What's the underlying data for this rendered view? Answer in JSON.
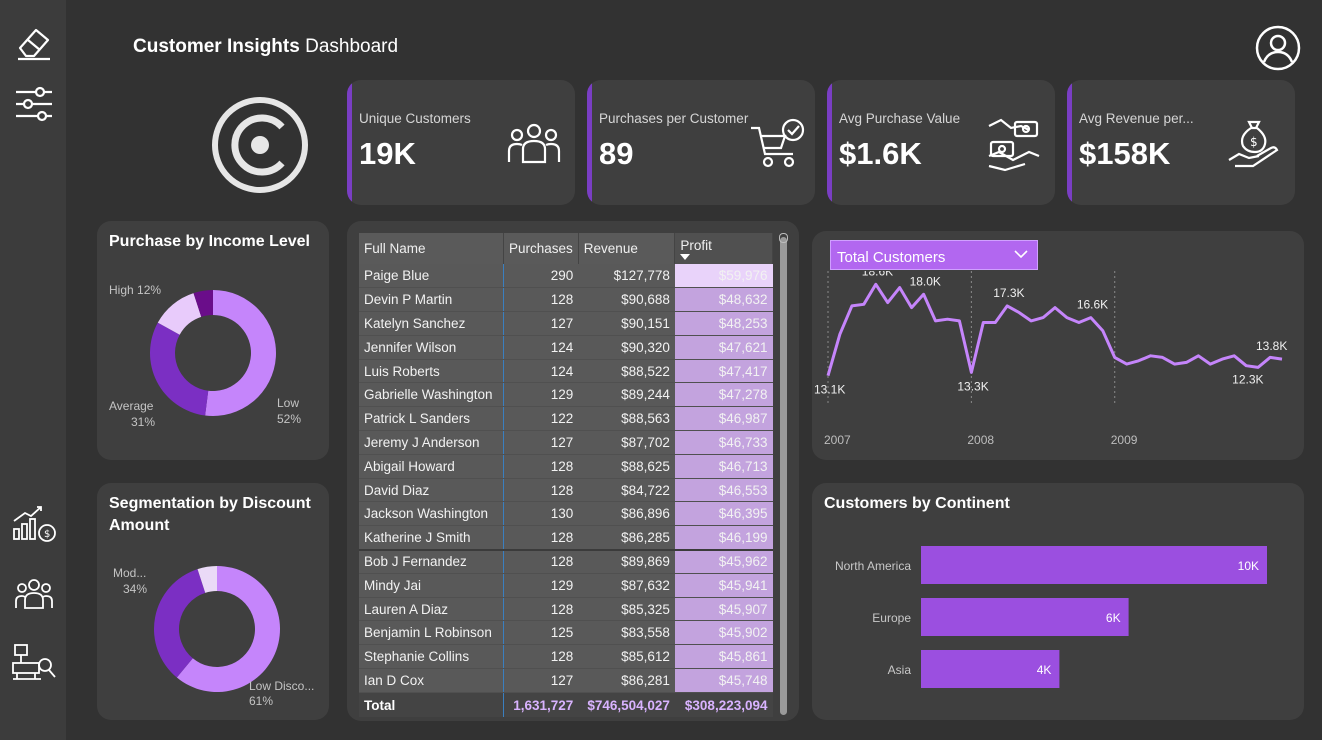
{
  "header": {
    "title_bold": "Customer Insights",
    "title_light": "Dashboard"
  },
  "sidebar": {
    "top_icons": [
      "eraser-icon",
      "sliders-icon"
    ],
    "bottom_icons": [
      "chart-money-icon",
      "people-icon",
      "inspect-icon"
    ]
  },
  "colors": {
    "accent": "#7a3ec4",
    "purple_light": "#c585fb",
    "purple_mid": "#9b4fe0",
    "purple_dark": "#6a1e9e",
    "pale": "#e8cbfb"
  },
  "kpis": [
    {
      "label": "Unique Customers",
      "value": "19K",
      "icon": "people-icon"
    },
    {
      "label": "Purchases per Customer",
      "value": "89",
      "icon": "cart-check-icon"
    },
    {
      "label": "Avg Purchase Value",
      "value": "$1.6K",
      "icon": "money-exchange-icon"
    },
    {
      "label": "Avg Revenue per...",
      "value": "$158K",
      "icon": "money-bag-hand-icon"
    }
  ],
  "income": {
    "title": "Purchase by Income Level",
    "labels": {
      "high": "High 12%",
      "average_name": "Average",
      "average_pct": "31%",
      "low_name": "Low",
      "low_pct": "52%"
    },
    "chart_data": {
      "type": "pie",
      "categories": [
        "Low",
        "Average",
        "High",
        "Other"
      ],
      "values": [
        52,
        31,
        12,
        5
      ]
    }
  },
  "discount": {
    "title": "Segmentation by Discount Amount",
    "labels": {
      "mod_name": "Mod...",
      "mod_pct": "34%",
      "low_name": "Low Disco...",
      "low_pct": "61%"
    },
    "chart_data": {
      "type": "pie",
      "categories": [
        "Low Disco...",
        "Mod...",
        "Other"
      ],
      "values": [
        61,
        34,
        5
      ]
    }
  },
  "table": {
    "columns": [
      "Full Name",
      "Purchases",
      "Revenue",
      "Profit"
    ],
    "rows": [
      [
        "Paige Blue",
        "290",
        "$127,778",
        "$59,976"
      ],
      [
        "Devin P Martin",
        "128",
        "$90,688",
        "$48,632"
      ],
      [
        "Katelyn Sanchez",
        "127",
        "$90,151",
        "$48,253"
      ],
      [
        "Jennifer Wilson",
        "124",
        "$90,320",
        "$47,621"
      ],
      [
        "Luis Roberts",
        "124",
        "$88,522",
        "$47,417"
      ],
      [
        "Gabrielle Washington",
        "129",
        "$89,244",
        "$47,278"
      ],
      [
        "Patrick L Sanders",
        "122",
        "$88,563",
        "$46,987"
      ],
      [
        "Jeremy J Anderson",
        "127",
        "$87,702",
        "$46,733"
      ],
      [
        "Abigail Howard",
        "128",
        "$88,625",
        "$46,713"
      ],
      [
        "David Diaz",
        "128",
        "$84,722",
        "$46,553"
      ],
      [
        "Jackson Washington",
        "130",
        "$86,896",
        "$46,395"
      ],
      [
        "Katherine J Smith",
        "128",
        "$86,285",
        "$46,199"
      ],
      [
        "Bob J Fernandez",
        "128",
        "$89,869",
        "$45,962"
      ],
      [
        "Mindy Jai",
        "129",
        "$87,632",
        "$45,941"
      ],
      [
        "Lauren A Diaz",
        "128",
        "$85,325",
        "$45,907"
      ],
      [
        "Benjamin L Robinson",
        "125",
        "$83,558",
        "$45,902"
      ],
      [
        "Stephanie Collins",
        "128",
        "$85,612",
        "$45,861"
      ],
      [
        "Ian D Cox",
        "127",
        "$86,281",
        "$45,748"
      ]
    ],
    "total": [
      "Total",
      "1,631,727",
      "$746,504,027",
      "$308,223,094"
    ]
  },
  "trend": {
    "dropdown_label": "Total Customers",
    "chart_data": {
      "type": "line",
      "x_ticks": [
        "2007",
        "2008",
        "2009"
      ],
      "values": [
        13.1,
        15.6,
        17.3,
        17.4,
        18.6,
        17.5,
        18.4,
        17.2,
        18.0,
        16.4,
        16.5,
        16.4,
        13.3,
        16.3,
        16.3,
        17.3,
        16.9,
        16.4,
        16.6,
        17.2,
        16.6,
        16.3,
        16.6,
        15.8,
        14.2,
        13.8,
        14.0,
        14.3,
        14.2,
        13.8,
        13.9,
        14.3,
        13.8,
        14.1,
        14.3,
        13.7,
        13.6,
        14.2,
        14.1
      ],
      "point_labels": [
        {
          "index": 0,
          "text": "13.1K"
        },
        {
          "index": 4,
          "text": "18.6K"
        },
        {
          "index": 8,
          "text": "18.0K"
        },
        {
          "index": 12,
          "text": "13.3K"
        },
        {
          "index": 15,
          "text": "17.3K"
        },
        {
          "index": 22,
          "text": "16.6K"
        },
        {
          "index": 35,
          "text": "12.3K"
        },
        {
          "index": 38,
          "text": "13.8K"
        }
      ]
    }
  },
  "continent": {
    "title": "Customers by Continent",
    "chart_data": {
      "type": "bar",
      "categories": [
        "North America",
        "Europe",
        "Asia"
      ],
      "values": [
        10,
        6,
        4
      ],
      "value_labels": [
        "10K",
        "6K",
        "4K"
      ]
    }
  }
}
